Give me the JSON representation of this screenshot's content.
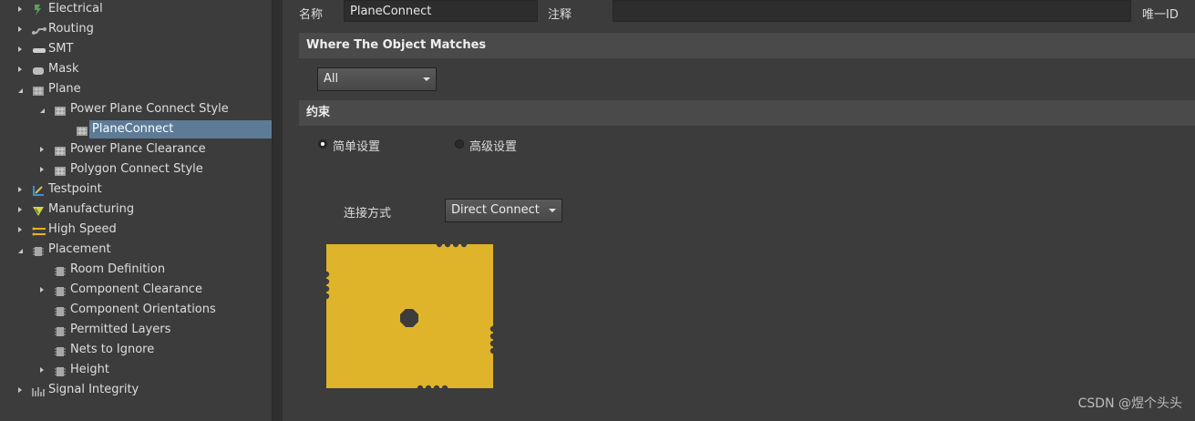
{
  "tree": {
    "items": [
      {
        "label": "Electrical",
        "icon": "electrical-icon",
        "caret": "collapsed",
        "indent": 0
      },
      {
        "label": "Routing",
        "icon": "routing-icon",
        "caret": "collapsed",
        "indent": 0
      },
      {
        "label": "SMT",
        "icon": "smt-icon",
        "caret": "collapsed",
        "indent": 0
      },
      {
        "label": "Mask",
        "icon": "mask-icon",
        "caret": "collapsed",
        "indent": 0
      },
      {
        "label": "Plane",
        "icon": "plane-icon",
        "caret": "expanded",
        "indent": 0
      },
      {
        "label": "Power Plane Connect Style",
        "icon": "plane-rule-icon",
        "caret": "expanded",
        "indent": 1
      },
      {
        "label": "PlaneConnect",
        "icon": "plane-rule-icon",
        "caret": "none",
        "indent": 2,
        "selected": true
      },
      {
        "label": "Power Plane Clearance",
        "icon": "plane-rule-icon",
        "caret": "collapsed",
        "indent": 1
      },
      {
        "label": "Polygon Connect Style",
        "icon": "plane-rule-icon",
        "caret": "collapsed",
        "indent": 1
      },
      {
        "label": "Testpoint",
        "icon": "testpoint-icon",
        "caret": "collapsed",
        "indent": 0
      },
      {
        "label": "Manufacturing",
        "icon": "manufacturing-icon",
        "caret": "collapsed",
        "indent": 0
      },
      {
        "label": "High Speed",
        "icon": "high-speed-icon",
        "caret": "collapsed",
        "indent": 0
      },
      {
        "label": "Placement",
        "icon": "placement-icon",
        "caret": "expanded",
        "indent": 0
      },
      {
        "label": "Room Definition",
        "icon": "placement-rule-icon",
        "caret": "none",
        "indent": 1
      },
      {
        "label": "Component Clearance",
        "icon": "placement-rule-icon",
        "caret": "collapsed",
        "indent": 1
      },
      {
        "label": "Component Orientations",
        "icon": "placement-rule-icon",
        "caret": "none",
        "indent": 1
      },
      {
        "label": "Permitted Layers",
        "icon": "placement-rule-icon",
        "caret": "none",
        "indent": 1
      },
      {
        "label": "Nets to Ignore",
        "icon": "placement-rule-icon",
        "caret": "none",
        "indent": 1
      },
      {
        "label": "Height",
        "icon": "placement-rule-icon",
        "caret": "collapsed",
        "indent": 1
      },
      {
        "label": "Signal Integrity",
        "icon": "signal-integrity-icon",
        "caret": "collapsed",
        "indent": 0
      }
    ]
  },
  "rule": {
    "name_label": "名称",
    "name_value": "PlaneConnect",
    "comment_label": "注释",
    "comment_value": "",
    "unique_id_label": "唯一ID"
  },
  "where_section": {
    "title": "Where The Object Matches",
    "scope_value": "All"
  },
  "constraints_section": {
    "title": "约束",
    "simple_label": "简单设置",
    "advanced_label": "高级设置",
    "simple_checked": true,
    "connect_style_label": "连接方式",
    "connect_style_value": "Direct Connect"
  },
  "colors": {
    "plane_fill": "#e0b42a",
    "selection": "#5d7b97",
    "background": "#3c3c3c"
  },
  "watermark": "CSDN @煜个头头"
}
